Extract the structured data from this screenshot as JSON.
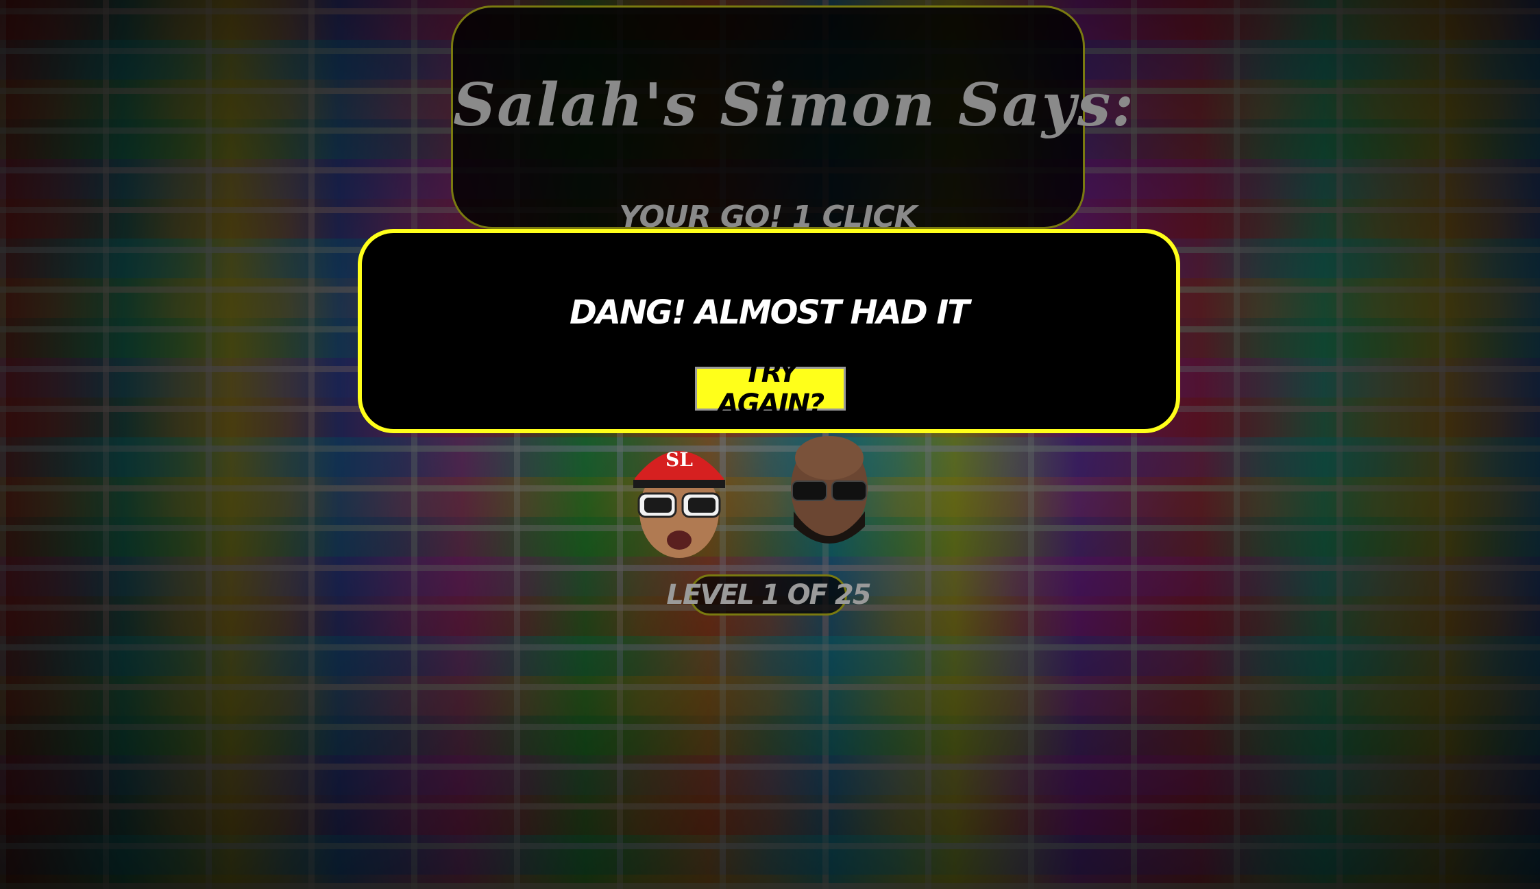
{
  "game": {
    "title": "Salah's Simon Says:",
    "status": "YOUR GO! 1 CLICK",
    "level": "LEVEL 1 OF 25"
  },
  "modal": {
    "message": "DANG! ALMOST HAD IT",
    "button_label": "TRY AGAIN?"
  },
  "faces": [
    {
      "icon": "rapper-with-red-cap-and-sunglasses"
    },
    {
      "icon": "bald-rapper-with-sunglasses-and-beard"
    }
  ],
  "colors": {
    "accent": "#ffff1a",
    "panel_border": "#7a7a10",
    "muted_text": "#8a8a8a",
    "modal_background": "#000000"
  }
}
